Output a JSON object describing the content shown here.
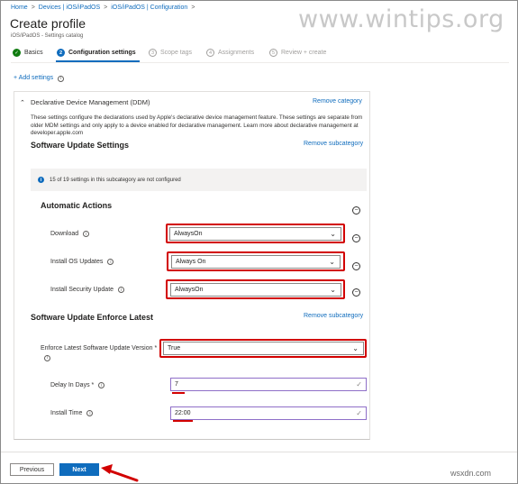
{
  "breadcrumb": [
    "Home",
    "Devices | iOS/iPadOS",
    "iOS/iPadOS | Configuration"
  ],
  "page": {
    "title": "Create profile",
    "subtitle": "iOS/iPadOS - Settings catalog"
  },
  "watermark": "www.wintips.org",
  "steps": [
    {
      "label": "Basics",
      "marker": "✓",
      "state": "done"
    },
    {
      "label": "Configuration settings",
      "marker": "2",
      "state": "current"
    },
    {
      "label": "Scope tags",
      "marker": "3",
      "state": "todo"
    },
    {
      "label": "Assignments",
      "marker": "4",
      "state": "todo"
    },
    {
      "label": "Review + create",
      "marker": "5",
      "state": "todo"
    }
  ],
  "add_settings": "+ Add settings",
  "category": {
    "title": "Declarative Device Management (DDM)",
    "remove_label": "Remove category",
    "description": "These settings configure the declarations used by Apple's declarative device management feature. These settings are separate from older MDM settings and only apply to a device enabled for declarative management. Learn more about declarative management at developer.apple.com"
  },
  "software_update": {
    "heading": "Software Update Settings",
    "remove_label": "Remove subcategory",
    "info_text": "15 of 19 settings in this subcategory are not configured",
    "automatic_actions": {
      "heading": "Automatic Actions",
      "rows": [
        {
          "label": "Download",
          "value": "AlwaysOn"
        },
        {
          "label": "Install OS Updates",
          "value": "Always On"
        },
        {
          "label": "Install Security Update",
          "value": "AlwaysOn"
        }
      ]
    }
  },
  "enforce_latest": {
    "heading": "Software Update Enforce Latest",
    "remove_label": "Remove subcategory",
    "version": {
      "label": "Enforce Latest Software Update Version *",
      "value": "True"
    },
    "delay": {
      "label": "Delay In Days *",
      "value": "7"
    },
    "install_time": {
      "label": "Install Time",
      "value": "22:00"
    }
  },
  "footer": {
    "previous": "Previous",
    "next": "Next"
  },
  "source_mark": "wsxdn.com",
  "colors": {
    "accent": "#0f6cbd",
    "highlight": "#d20000",
    "success": "#107c10"
  }
}
